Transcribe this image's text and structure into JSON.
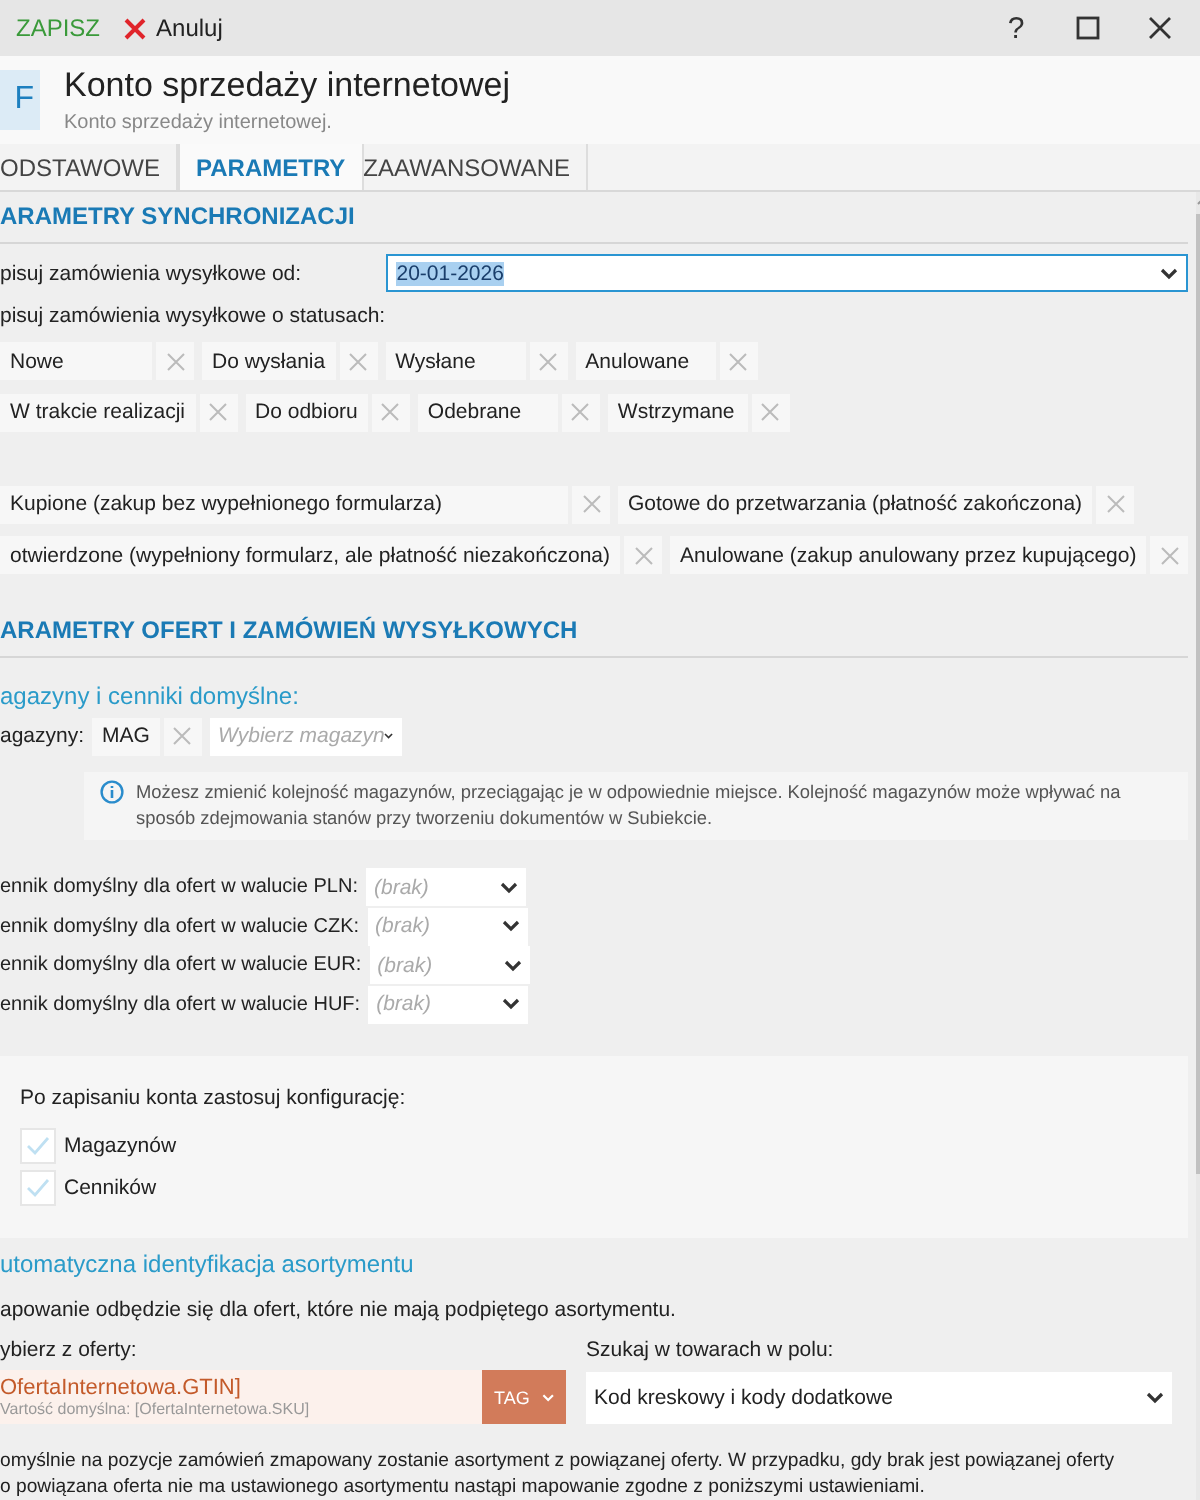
{
  "toolbar": {
    "save": "ZAPISZ",
    "cancel": "Anuluj",
    "help": "?"
  },
  "header": {
    "logo": "F",
    "title": "Konto sprzedaży internetowej",
    "subtitle": "Konto sprzedaży internetowej."
  },
  "tabs": [
    {
      "label": "ODSTAWOWE",
      "selected": false
    },
    {
      "label": "PARAMETRY",
      "selected": true
    },
    {
      "label": "ZAAWANSOWANE",
      "selected": false
    }
  ],
  "sync": {
    "heading": "ARAMETRY SYNCHRONIZACJI",
    "date_label": "pisuj zamówienia wysyłkowe od:",
    "date_value": "20-01-2026",
    "status_label": "pisuj zamówienia wysyłkowe o statusach:",
    "status_rows": [
      [
        "Nowe",
        "Do wysłania",
        "Wysłane",
        "Anulowane"
      ],
      [
        "W trakcie realizacji",
        "Do odbioru",
        "Odebrane",
        "Wstrzymane"
      ]
    ],
    "extra_rows": [
      [
        "Kupione (zakup bez wypełnionego formularza)",
        "Gotowe do przetwarzania (płatność zakończona)"
      ],
      [
        "otwierdzone (wypełniony formularz, ale płatność niezakończona)",
        "Anulowane (zakup anulowany przez kupującego)"
      ]
    ]
  },
  "offers": {
    "heading": "ARAMETRY OFERT I ZAMÓWIEŃ WYSYŁKOWYCH",
    "subheading": "agazyny i cenniki domyślne:",
    "warehouse_label": "agazyny:",
    "warehouse_chip": "MAG",
    "warehouse_placeholder": "Wybierz magazyn",
    "info": "Możesz zmienić kolejność magazynów, przeciągając je w odpowiednie miejsce. Kolejność magazynów może wpływać na sposób zdejmowania stanów przy tworzeniu dokumentów w Subiekcie.",
    "price_lists": [
      {
        "label": "ennik domyślny dla ofert w walucie PLN:",
        "placeholder": "(brak)"
      },
      {
        "label": "ennik domyślny dla ofert w walucie CZK:",
        "placeholder": "(brak)"
      },
      {
        "label": "ennik domyślny dla ofert w walucie EUR:",
        "placeholder": "(brak)"
      },
      {
        "label": "ennik domyślny dla ofert w walucie HUF:",
        "placeholder": "(brak)"
      }
    ],
    "config": {
      "title": "Po zapisaniu konta zastosuj konfigurację:",
      "options": [
        {
          "label": "Magazynów",
          "checked": true
        },
        {
          "label": "Cenników",
          "checked": true
        }
      ]
    }
  },
  "auto": {
    "heading": "utomatyczna identyfikacja asortymentu",
    "note": "apowanie odbędzie się dla ofert, które nie mają podpiętego asortymentu.",
    "pick_label": "ybierz z oferty:",
    "pick_value": "OfertaInternetowa.GTIN]",
    "pick_default": "Vartość domyślna: [OfertaInternetowa.SKU]",
    "tag": "TAG",
    "search_label": "Szukaj w towarach w polu:",
    "search_value": "Kod kreskowy i kody dodatkowe",
    "paragraph": "omyślnie na pozycje zamówień zmapowany zostanie asortyment z powiązanej oferty. W przypadku, gdy brak jest powiązanej oferty\no powiązana oferta nie ma ustawionego asortymentu nastąpi mapowanie zgodne z poniższymi ustawieniami."
  }
}
